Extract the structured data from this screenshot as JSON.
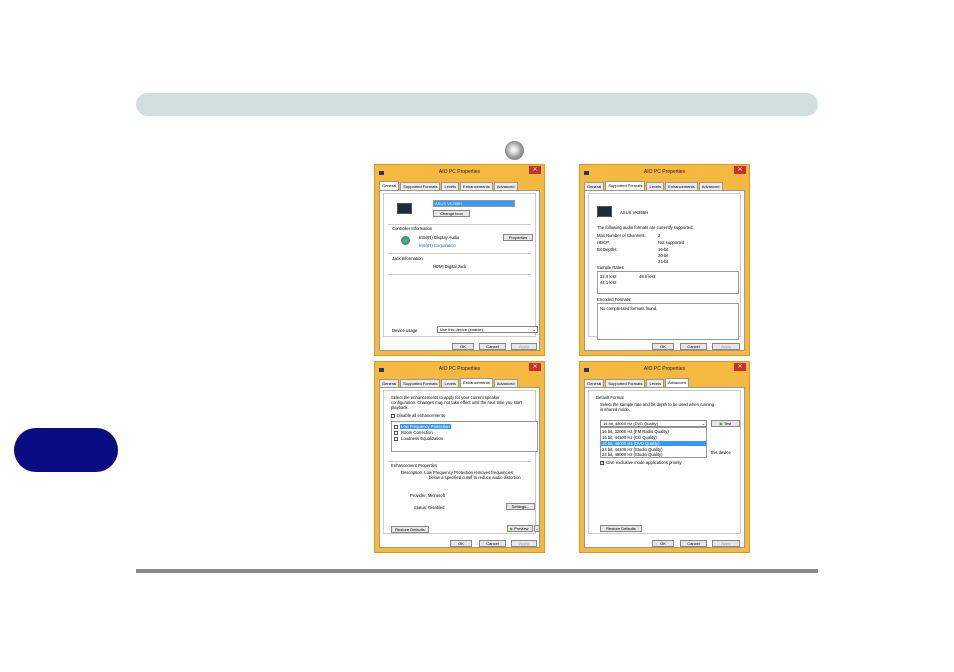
{
  "dialog_title": "AIO PC Properties",
  "close_glyph": "✕",
  "dropdown_glyph": "⌄",
  "buttons": {
    "ok": "OK",
    "cancel": "Cancel",
    "apply": "Apply"
  },
  "general": {
    "tabs": [
      "General",
      "Supported Formats",
      "Levels",
      "Enhancements",
      "Advanced"
    ],
    "device_name": "ASUS VK266H",
    "change_icon": "Change Icon",
    "controller_info": "Controller Information",
    "controller_name": "Intel(R) Display Audio",
    "controller_vendor": "Intel(R) Corporation",
    "properties": "Properties",
    "jack_info": "Jack Information",
    "jack_name": "HDMI Digital Jack",
    "device_usage_label": "Device usage:",
    "device_usage_value": "Use this device (enable)"
  },
  "formats": {
    "tabs": [
      "General",
      "Supported Formats",
      "Levels",
      "Enhancements",
      "Advanced"
    ],
    "device_name": "ASUS VK266H",
    "intro": "The following audio formats are currently supported:",
    "max_channels_label": "Max Number of Channels:",
    "max_channels_value": "2",
    "hdcp_label": "HDCP:",
    "hdcp_value": "Not supported",
    "bit_depths_label": "Bit Depths:",
    "bit_depths": [
      "16-bit",
      "20-bit",
      "24-bit"
    ],
    "sample_rates_label": "Sample Rates:",
    "sample_rates": [
      "32.0 kHz",
      "48.0 kHz",
      "44.1 kHz"
    ],
    "encoded_label": "Encoded Formats:",
    "encoded_value": "No compressed formats found."
  },
  "enhancements": {
    "tabs": [
      "General",
      "Supported Formats",
      "Levels",
      "Enhancements",
      "Advanced"
    ],
    "intro_line1": "Select the enhancements to apply for your current speaker",
    "intro_line2": "configuration. Changes may not take effect until the next time you start",
    "intro_line3": "playback.",
    "disable_all": "Disable all enhancements",
    "items": [
      "Low Frequency Protection",
      "Room Correction",
      "Loudness Equalization"
    ],
    "props_title": "Enhancement Properties",
    "description_line1": "Description: Low Frequency Protection removes frequencies",
    "description_line2": "below a specified cutoff to reduce audio distortion",
    "provider": "Provider: Microsoft",
    "status": "Status: Disabled",
    "settings": "Settings...",
    "restore": "Restore Defaults",
    "preview": "Preview"
  },
  "advanced": {
    "tabs": [
      "General",
      "Supported Formats",
      "Levels",
      "Advanced"
    ],
    "default_format": "Default Format",
    "instr_line1": "Select the sample rate and bit depth to be used when running",
    "instr_line2": "in shared mode.",
    "selected_format": "16 bit, 48000 Hz (DVD Quality)",
    "test": "Test",
    "options": [
      "16 bit, 32000 Hz (FM Radio Quality)",
      "16 bit, 44100 Hz (CD Quality)",
      "16 bit, 48000 Hz (DVD Quality)",
      "24 bit, 44100 Hz (Studio Quality)",
      "24 bit, 48000 Hz (Studio Quality)"
    ],
    "exclusive_fragment": "this device",
    "priority": "Give exclusive mode applications priority",
    "restore": "Restore Defaults"
  },
  "colors": {
    "header_bar": "#cfe0df",
    "chapter_tab": "#0c0c82",
    "window_frame": "#f5b940",
    "close_button": "#c9302c"
  }
}
